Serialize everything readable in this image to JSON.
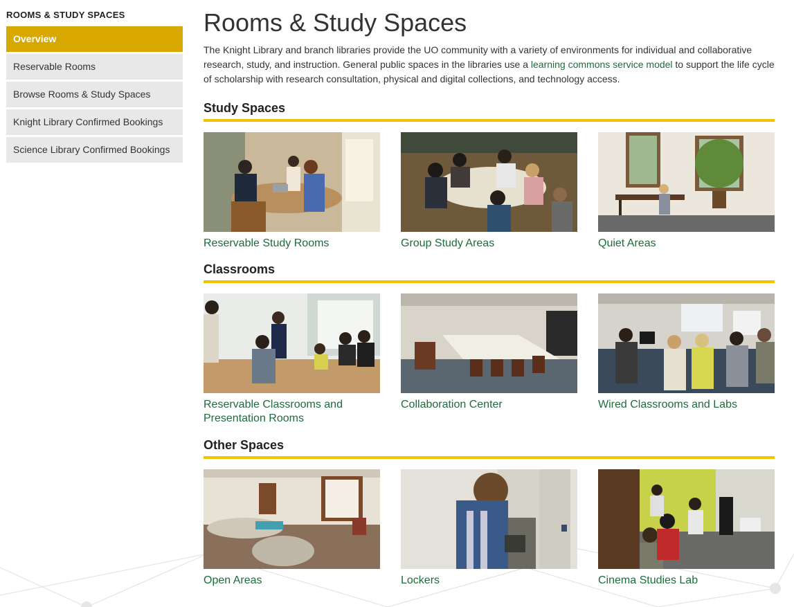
{
  "sidebar": {
    "heading": "ROOMS & STUDY SPACES",
    "items": [
      {
        "label": "Overview",
        "active": true
      },
      {
        "label": "Reservable Rooms",
        "active": false
      },
      {
        "label": "Browse Rooms & Study Spaces",
        "active": false
      },
      {
        "label": "Knight Library Confirmed Bookings",
        "active": false
      },
      {
        "label": "Science Library Confirmed Bookings",
        "active": false
      }
    ]
  },
  "main": {
    "title": "Rooms & Study Spaces",
    "intro": {
      "before": "The Knight Library and branch libraries provide the UO community with a variety of environments for individual and collaborative research, study, and instruction. General public spaces in the libraries use a ",
      "link": "learning commons service model",
      "after": " to support the life cycle of scholarship with research consultation, physical and digital collections, and technology access."
    },
    "sections": [
      {
        "title": "Study Spaces",
        "cards": [
          {
            "label": "Reservable Study Rooms"
          },
          {
            "label": "Group Study Areas"
          },
          {
            "label": "Quiet Areas"
          }
        ]
      },
      {
        "title": "Classrooms",
        "cards": [
          {
            "label": "Reservable Classrooms and Presentation Rooms"
          },
          {
            "label": "Collaboration Center"
          },
          {
            "label": "Wired Classrooms and Labs"
          }
        ]
      },
      {
        "title": "Other Spaces",
        "cards": [
          {
            "label": "Open Areas"
          },
          {
            "label": "Lockers"
          },
          {
            "label": "Cinema Studies Lab"
          }
        ]
      }
    ]
  },
  "colors": {
    "accent_gold": "#d9a800",
    "rule_yellow": "#f2c400",
    "link_green": "#1e6b3c"
  }
}
